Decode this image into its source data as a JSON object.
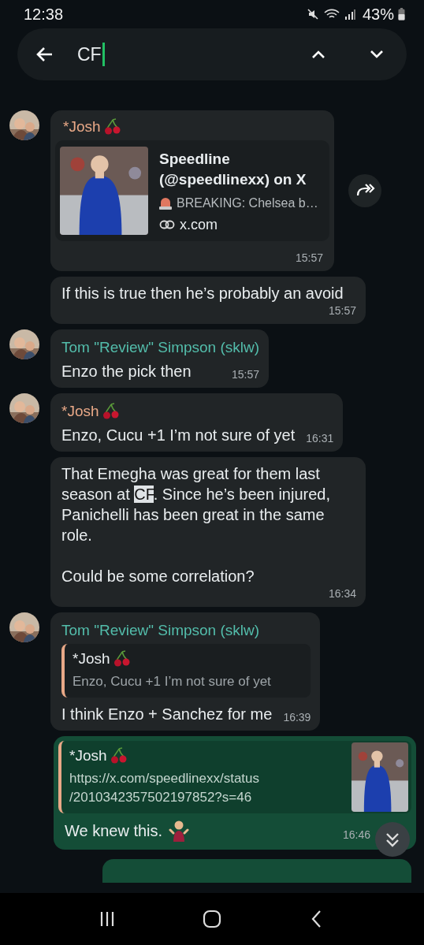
{
  "status_bar": {
    "time": "12:38",
    "battery": "43%"
  },
  "search": {
    "value": "CF"
  },
  "messages": [
    {
      "kind": "link_preview",
      "outgoing": false,
      "sender": "*Josh",
      "color": "#e8a887",
      "avatar": true,
      "preview": {
        "title": "Speedline (@speedlinexx) on X",
        "description": "BREAKING: Chelsea b…",
        "domain": "x.com"
      },
      "time": "15:57"
    },
    {
      "kind": "text",
      "outgoing": false,
      "segments": [
        {
          "text": "If this is true then he’s probably an avoid",
          "highlighted": false
        }
      ],
      "time": "15:57"
    },
    {
      "kind": "text",
      "outgoing": false,
      "sender": "Tom \"Review\" Simpson (sklw)",
      "color": "#53bdab",
      "avatar": true,
      "segments": [
        {
          "text": "Enzo the pick then",
          "highlighted": false
        }
      ],
      "time": "15:57"
    },
    {
      "kind": "text",
      "outgoing": false,
      "sender": "*Josh",
      "color": "#e8a887",
      "avatar": true,
      "segments": [
        {
          "text": "Enzo, Cucu +1 I’m not sure of yet",
          "highlighted": false
        }
      ],
      "time": "16:31"
    },
    {
      "kind": "text",
      "outgoing": false,
      "segments": [
        {
          "text": "That Emegha was great for them last season at ",
          "highlighted": false
        },
        {
          "text": "CF",
          "highlighted": true
        },
        {
          "text": ". Since he’s been injured, Panichelli has been great in the same role.\n\nCould be some correlation?",
          "highlighted": false
        }
      ],
      "time": "16:34"
    },
    {
      "kind": "quote",
      "outgoing": false,
      "sender": "Tom \"Review\" Simpson (sklw)",
      "color": "#53bdab",
      "avatar": true,
      "quote": {
        "sender": "*Josh",
        "text": "Enzo, Cucu +1 I’m not sure of yet",
        "thumbnail": false
      },
      "segments": [
        {
          "text": "I think Enzo + Sanchez for me",
          "highlighted": false
        }
      ],
      "time": "16:39"
    },
    {
      "kind": "quote",
      "outgoing": true,
      "quote": {
        "sender": "*Josh",
        "text": "https://x.com/speedlinexx/status/2010342357502197852?s=46",
        "thumbnail": true
      },
      "segments": [
        {
          "text": "We knew this.",
          "highlighted": false
        }
      ],
      "emoji": true,
      "time": "16:46"
    }
  ]
}
